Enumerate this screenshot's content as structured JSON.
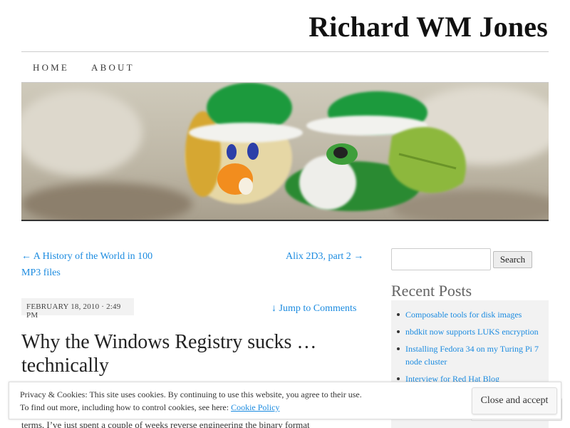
{
  "site": {
    "title": "Richard WM Jones"
  },
  "nav": {
    "items": [
      {
        "label": "HOME"
      },
      {
        "label": "ABOUT"
      }
    ]
  },
  "post_nav": {
    "prev_label": "← A History of the World in 100 MP3 files",
    "next_label": "Alix 2D3, part 2 →"
  },
  "post": {
    "date": "FEBRUARY 18, 2010 · 2:49 PM",
    "jump_label": "↓ Jump to Comments",
    "title": "Why the Windows Registry sucks … technically",
    "body_fragment": "terms, I’ve just spent a couple of weeks reverse engineering the binary format"
  },
  "sidebar": {
    "search_placeholder": "",
    "search_button": "Search",
    "recent_heading": "Recent Posts",
    "recent_posts": [
      "Composable tools for disk images",
      "nbdkit now supports LUKS encryption",
      "Installing Fedora 34 on my Turing Pi 7 node cluster",
      "Interview for Red Hat Blog"
    ]
  },
  "cookie_bar": {
    "line1": "Privacy & Cookies: This site uses cookies. By continuing to use this website, you agree to their use.",
    "line2": "To find out more, including how to control cookies, see here:",
    "link": "Cookie Policy",
    "close_button": "Close and accept"
  },
  "colors": {
    "link": "#1b8be0",
    "text": "#373737"
  },
  "icons": {
    "header_image": "plasticine-figures-photo"
  }
}
